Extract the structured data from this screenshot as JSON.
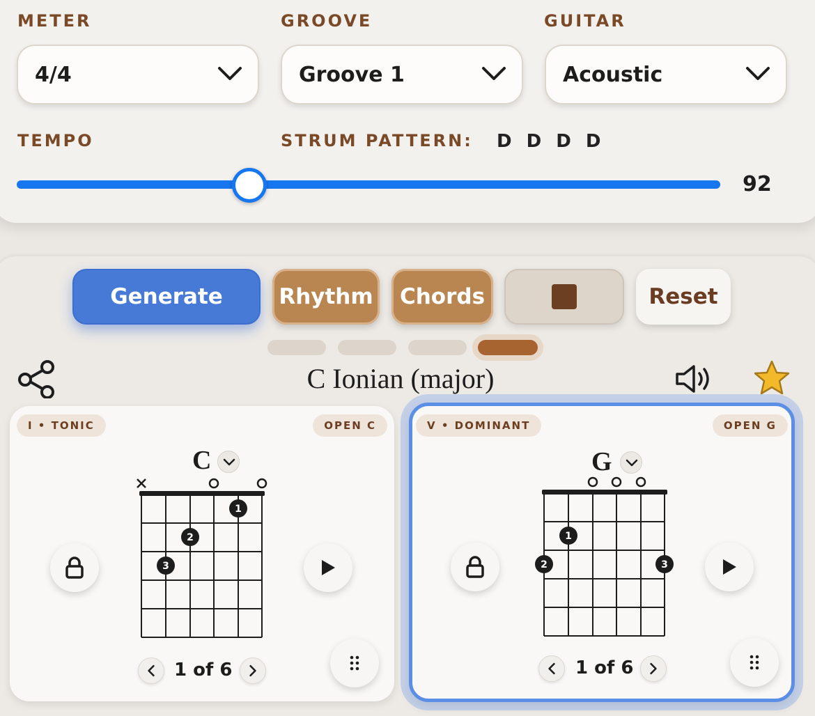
{
  "settings": {
    "meter": {
      "label": "METER",
      "value": "4/4"
    },
    "groove": {
      "label": "GROOVE",
      "value": "Groove 1"
    },
    "guitar": {
      "label": "GUITAR",
      "value": "Acoustic"
    },
    "tempo": {
      "label": "TEMPO",
      "value": "92",
      "slider_fraction": 0.33
    },
    "strum": {
      "label": "STRUM PATTERN:",
      "value": "D D D D"
    }
  },
  "actions": {
    "generate": "Generate",
    "rhythm": "Rhythm",
    "chords": "Chords",
    "stop": "stop-icon",
    "reset": "Reset"
  },
  "pager": {
    "count": 4,
    "active_index": 3
  },
  "key_title": "C Ionian (major)",
  "header_icons": [
    "share-icon",
    "speaker-icon",
    "star-icon"
  ],
  "colors": {
    "accent_blue": "#1677f0",
    "brown_label": "#7a4a28",
    "star": "#f2b92a"
  },
  "cards": [
    {
      "role": "I • TONIC",
      "voicing_name": "OPEN C",
      "chord": "C",
      "voicing_position": "1 of 6",
      "selected": false,
      "muted_strings": [
        1
      ],
      "open_strings": [
        4,
        6
      ],
      "fingers": [
        {
          "finger": "1",
          "string": 5,
          "fret": 1
        },
        {
          "finger": "2",
          "string": 3,
          "fret": 2
        },
        {
          "finger": "3",
          "string": 2,
          "fret": 3
        }
      ]
    },
    {
      "role": "V • DOMINANT",
      "voicing_name": "OPEN G",
      "chord": "G",
      "voicing_position": "1 of 6",
      "selected": true,
      "muted_strings": [],
      "open_strings": [
        3,
        4,
        5
      ],
      "fingers": [
        {
          "finger": "1",
          "string": 2,
          "fret": 2
        },
        {
          "finger": "2",
          "string": 1,
          "fret": 3
        },
        {
          "finger": "3",
          "string": 6,
          "fret": 3
        }
      ]
    }
  ]
}
